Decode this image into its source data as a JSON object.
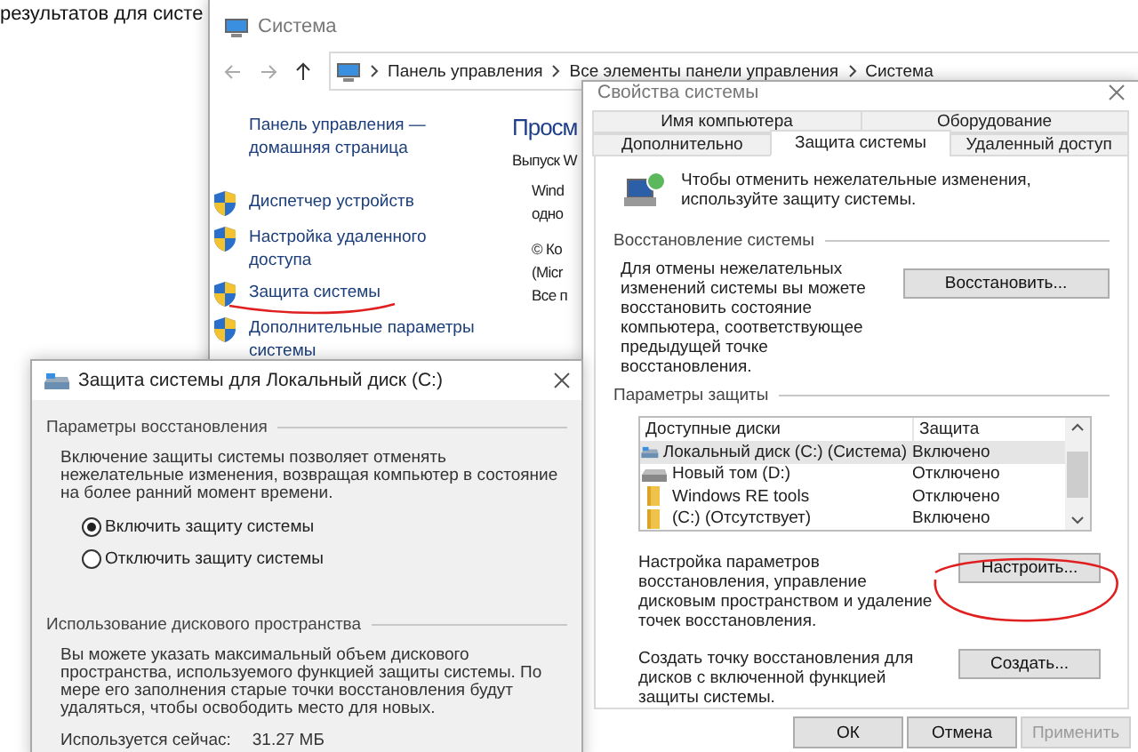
{
  "background_text": "результатов для систе",
  "system_window": {
    "title": "Система",
    "address": [
      "Панель управления",
      "Все элементы панели управления",
      "Система"
    ],
    "sidebar": {
      "home_link": "Панель управления — домашняя страница",
      "items": [
        "Диспетчер устройств",
        "Настройка удаленного доступа",
        "Защита системы",
        "Дополнительные параметры системы"
      ]
    },
    "main": {
      "heading": "Просм",
      "edition_label": "Выпуск W",
      "lines": [
        "Wind",
        "одно"
      ],
      "copyright_lines": [
        "© Ко",
        "(Micr",
        "Все п"
      ]
    }
  },
  "properties_dialog": {
    "title": "Свойства системы",
    "tab_rows": [
      [
        {
          "label": "Имя компьютера",
          "selected": false
        },
        {
          "label": "Оборудование",
          "selected": false
        }
      ],
      [
        {
          "label": "Дополнительно",
          "selected": false
        },
        {
          "label": "Защита системы",
          "selected": true
        },
        {
          "label": "Удаленный доступ",
          "selected": false
        }
      ]
    ],
    "intro": "Чтобы отменить нежелательные изменения, используйте защиту системы.",
    "restore_group": {
      "heading": "Восстановление системы",
      "text": "Для отмены нежелательных изменений системы вы можете восстановить состояние компьютера, соответствующее предыдущей точке восстановления.",
      "button": "Восстановить..."
    },
    "protection_group": {
      "heading": "Параметры защиты",
      "columns": [
        "Доступные диски",
        "Защита"
      ],
      "rows": [
        {
          "drive": "Локальный диск (C:) (Система)",
          "kind": "system",
          "status": "Включено",
          "selected": true
        },
        {
          "drive": "Новый том (D:)",
          "kind": "disk",
          "status": "Отключено",
          "selected": false
        },
        {
          "drive": "Windows RE tools",
          "kind": "folder",
          "status": "Отключено",
          "selected": false
        },
        {
          "drive": "(C:) (Отсутствует)",
          "kind": "folder",
          "status": "Включено",
          "selected": false
        }
      ],
      "configure": {
        "text": "Настройка параметров восстановления, управление дисковым пространством и удаление точек восстановления.",
        "button": "Настроить..."
      },
      "create": {
        "text": "Создать точку восстановления для дисков с включенной функцией защиты системы.",
        "button": "Создать..."
      }
    },
    "buttons": [
      {
        "label": "ОК",
        "disabled": false
      },
      {
        "label": "Отмена",
        "disabled": false
      },
      {
        "label": "Применить",
        "disabled": true
      }
    ]
  },
  "drive_dialog": {
    "title": "Защита системы для Локальный диск (C:)",
    "restore_group": {
      "heading": "Параметры восстановления",
      "text": "Включение защиты системы позволяет отменять нежелательные изменения, возвращая компьютер в состояние на более ранний момент времени.",
      "options": [
        {
          "label": "Включить защиту системы",
          "selected": true
        },
        {
          "label": "Отключить защиту системы",
          "selected": false
        }
      ]
    },
    "disk_group": {
      "heading": "Использование дискового пространства",
      "text": "Вы можете указать максимальный объем дискового пространства, используемого функцией защиты системы. По мере его заполнения старые точки восстановления будут удаляться, чтобы освободить место для новых.",
      "usage_label": "Используется сейчас:",
      "usage_value": "31.27 МБ"
    }
  }
}
